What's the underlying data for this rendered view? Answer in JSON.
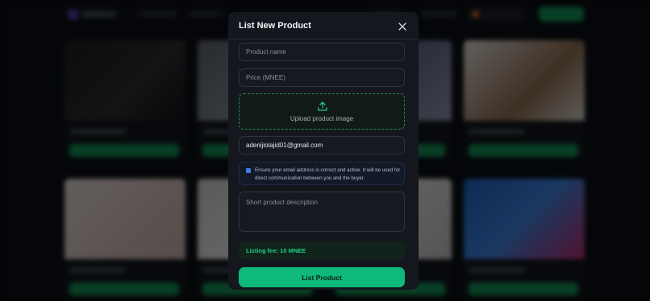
{
  "modal": {
    "title": "List New Product",
    "close_icon": "close-icon"
  },
  "form": {
    "product_name": {
      "placeholder": "Product name",
      "value": ""
    },
    "price": {
      "placeholder": "Price (MNEE)",
      "value": ""
    },
    "upload": {
      "label": "Upload product image",
      "icon": "upload-icon"
    },
    "email": {
      "value": "adenijiolajid01@gmail.com"
    },
    "notice": {
      "text": "Ensure your email address is correct and active. It will be used for direct communication between you and the buyer.",
      "icon": "info-icon"
    },
    "description": {
      "placeholder": "Short product description",
      "value": ""
    },
    "fee": "Listing fee: 10 MNEE",
    "submit_label": "List Product"
  },
  "colors": {
    "accent": "#0fb97b",
    "modal_bg": "#14181e",
    "fee_text": "#1fcf82",
    "notice_border": "#1f2c46"
  }
}
